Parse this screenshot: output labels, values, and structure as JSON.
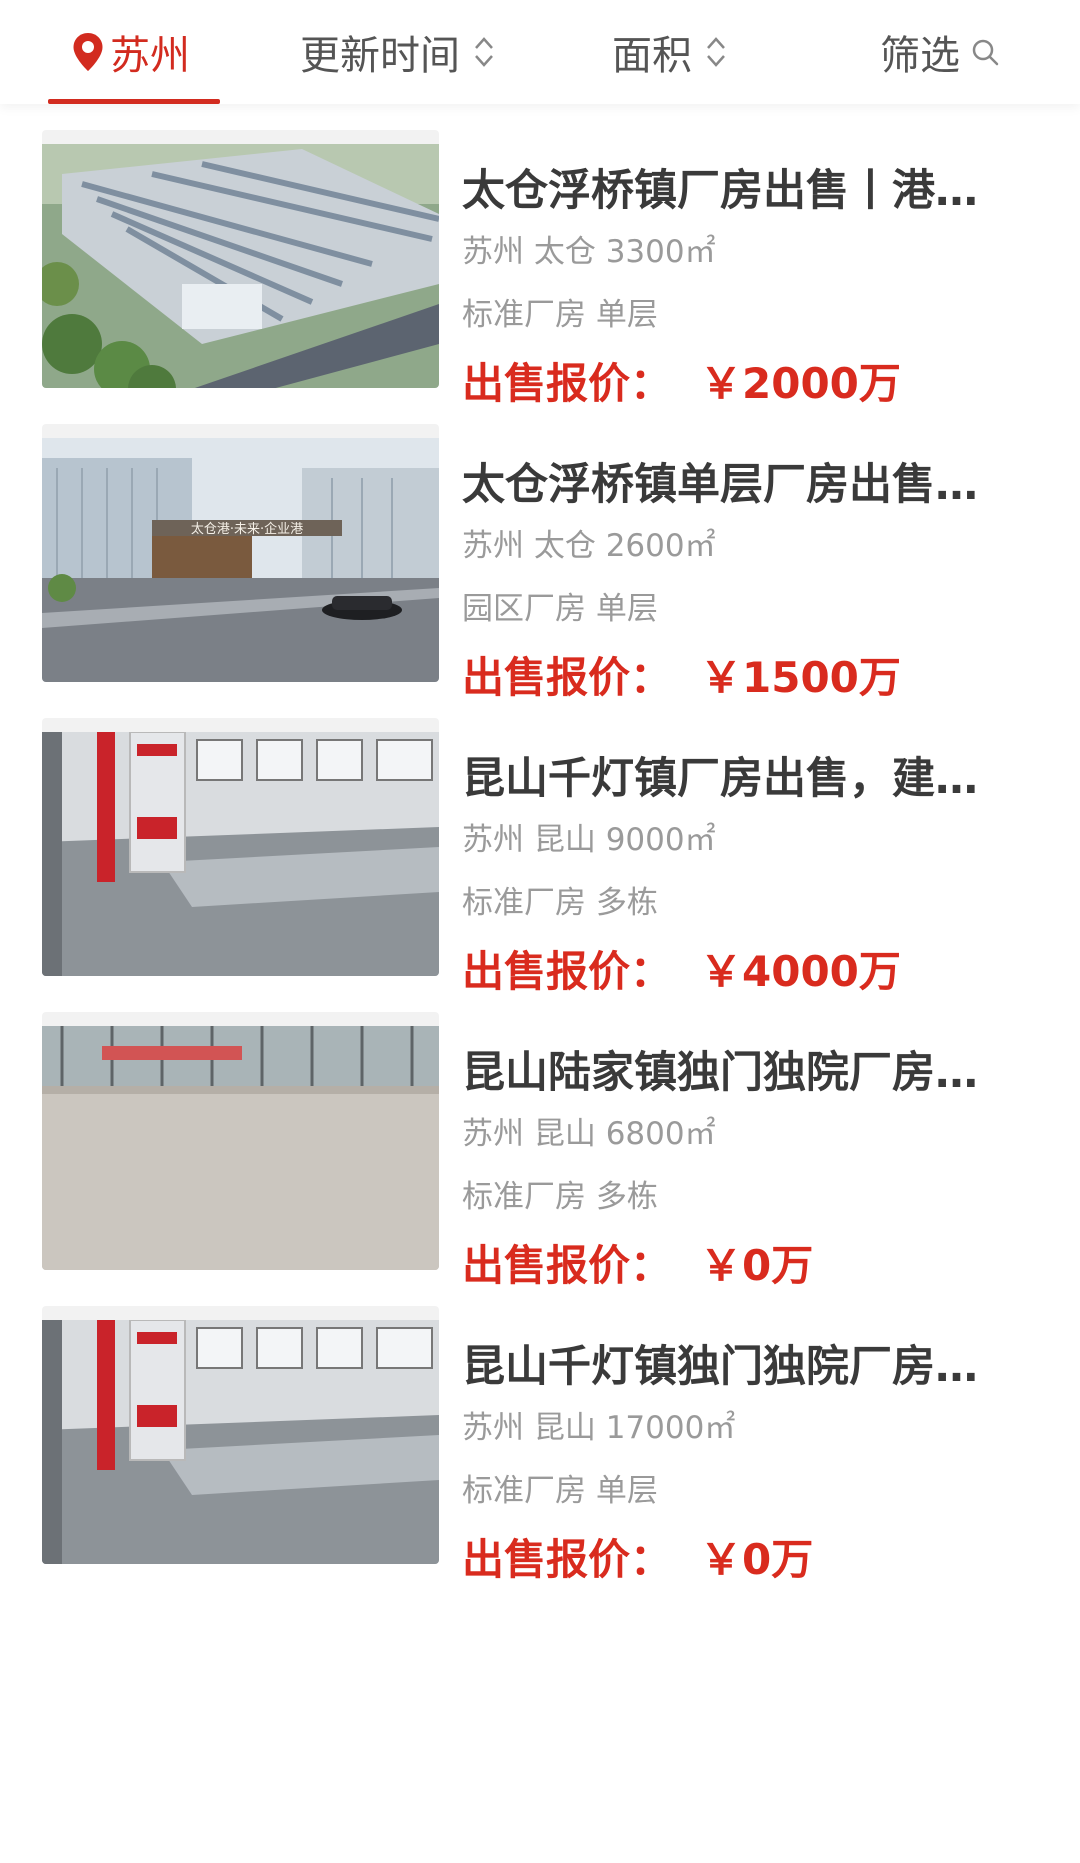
{
  "header": {
    "city": "苏州",
    "update_time": "更新时间",
    "area": "面积",
    "filter": "筛选"
  },
  "listings": [
    {
      "title": "太仓浮桥镇厂房出售丨港…",
      "location": "苏州 太仓 3300㎡",
      "type": "标准厂房 单层",
      "price_label": "出售报价：",
      "price": "￥2000万",
      "image_icon": "factory-aerial-photo"
    },
    {
      "title": "太仓浮桥镇单层厂房出售…",
      "location": "苏州 太仓 2600㎡",
      "type": "园区厂房 单层",
      "price_label": "出售报价：",
      "price": "￥1500万",
      "image_icon": "industrial-park-gate-photo",
      "image_sign": "太仓港·未来·企业港"
    },
    {
      "title": "昆山千灯镇厂房出售，建…",
      "location": "苏州 昆山 9000㎡",
      "type": "标准厂房 多栋",
      "price_label": "出售报价：",
      "price": "￥4000万",
      "image_icon": "factory-interior-photo"
    },
    {
      "title": "昆山陆家镇独门独院厂房…",
      "location": "苏州 昆山 6800㎡",
      "type": "标准厂房 多栋",
      "price_label": "出售报价：",
      "price": "￥0万",
      "image_icon": "empty-warehouse-photo"
    },
    {
      "title": "昆山千灯镇独门独院厂房…",
      "location": "苏州 昆山 17000㎡",
      "type": "标准厂房 单层",
      "price_label": "出售报价：",
      "price": "￥0万",
      "image_icon": "factory-interior-photo"
    }
  ],
  "colors": {
    "accent": "#d22b1f",
    "price": "#d92b1e",
    "title": "#3a3a3a",
    "meta": "#9a9a9a"
  }
}
